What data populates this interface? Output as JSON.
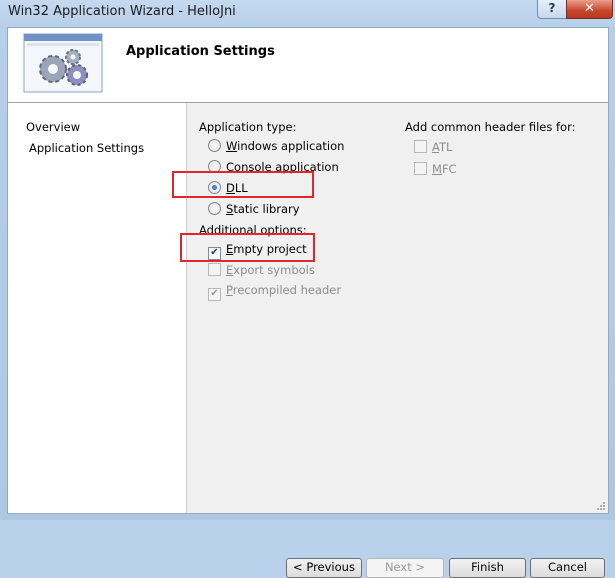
{
  "window": {
    "title": "Win32 Application Wizard - HelloJni",
    "help_label": "?",
    "close_label": "✕"
  },
  "header": {
    "title": "Application Settings",
    "image_icon": "gears-icon"
  },
  "nav": {
    "items": [
      {
        "label": "Overview"
      },
      {
        "label": "Application Settings"
      }
    ]
  },
  "application_type": {
    "label": "Application type:",
    "options": [
      {
        "label": "Windows application",
        "checked": false
      },
      {
        "label": "Console application",
        "checked": false
      },
      {
        "label": "DLL",
        "checked": true
      },
      {
        "label": "Static library",
        "checked": false
      }
    ]
  },
  "additional_options": {
    "label": "Additional options:",
    "options": [
      {
        "label": "Empty project",
        "checked": true,
        "enabled": true
      },
      {
        "label": "Export symbols",
        "checked": false,
        "enabled": false
      },
      {
        "label": "Precompiled header",
        "checked": true,
        "enabled": false
      }
    ]
  },
  "common_headers": {
    "label": "Add common header files for:",
    "options": [
      {
        "label": "ATL",
        "checked": false,
        "enabled": false
      },
      {
        "label": "MFC",
        "checked": false,
        "enabled": false
      }
    ]
  },
  "buttons": {
    "previous": "< Previous",
    "next": "Next >",
    "finish": "Finish",
    "cancel": "Cancel"
  },
  "colors": {
    "highlight": "#e3262b",
    "accent": "#1d57b0"
  }
}
